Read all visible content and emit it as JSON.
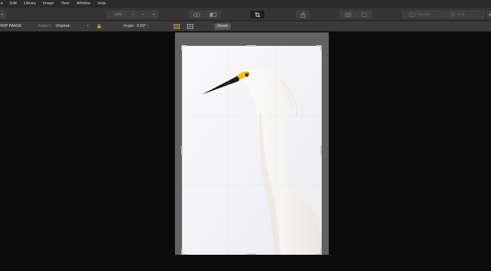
{
  "menu": [
    "e",
    "Edit",
    "Library",
    "Image",
    "View",
    "Window",
    "Help"
  ],
  "toolbar": {
    "zoom": "16%",
    "library_label": "Library",
    "edit_label": "Edit"
  },
  "crop_options": {
    "title": "ROP IMAGE",
    "aspect_label": "Aspect:",
    "aspect_value": "Original",
    "angle_label": "Angle:",
    "angle_value": "0.00°",
    "reset_label": "Reset"
  },
  "colors": {
    "accent": "#e0a020",
    "menubar": "#2a2a2a",
    "toolbar": "#353535",
    "canvas": "#0b0b0b",
    "beak": "#1b1b1b",
    "lores": "#f2c10e"
  },
  "icons": [
    "plus-icon",
    "zoom-out-icon",
    "zoom-in-icon",
    "eye-icon",
    "compare-icon",
    "crop-icon",
    "share-icon",
    "grid-view-icon",
    "single-view-icon",
    "library-icon",
    "edit-sliders-icon",
    "lock-icon",
    "grid-overlay-icon",
    "guides-icon"
  ]
}
